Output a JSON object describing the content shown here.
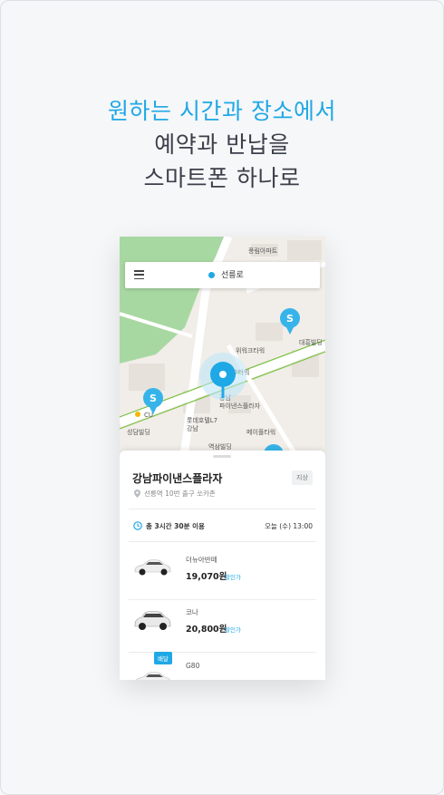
{
  "headline": {
    "line1": "원하는 시간과 장소에서",
    "line2": "예약과 반납을",
    "line3": "스마트폰 하나로"
  },
  "colors": {
    "accent": "#1fa8e6",
    "text_dark": "#3a3f4a",
    "map_park": "#a8d8a2",
    "map_road_green": "#7cc242"
  },
  "search": {
    "text": "선릉로"
  },
  "map_labels": {
    "poi1": "풍림아파트",
    "poi2": "위워크타워",
    "poi3": "대흥빌딩",
    "poi4": "7타워",
    "poi5": "강남",
    "poi6": "파이낸스플라자",
    "poi7": "롯데호텔L7",
    "poi8": "강남",
    "poi9": "메이플타워",
    "poi10": "CU",
    "poi11": "성담빌딩",
    "poi12": "역삼빌딩",
    "marker_letter": "S"
  },
  "place": {
    "name": "강남파이낸스플라자",
    "badge": "지상",
    "sub": "선릉역 10번 출구 쏘카존"
  },
  "booking": {
    "duration": "총 3시간 30분 이용",
    "date": "오늘 (수) 13:00"
  },
  "cars": [
    {
      "name": "더뉴아반떼",
      "price": "19,070원",
      "discount": "할인가"
    },
    {
      "name": "코나",
      "price": "20,800원",
      "discount": "할인가"
    },
    {
      "name": "G80",
      "ribbon": "배달"
    }
  ]
}
